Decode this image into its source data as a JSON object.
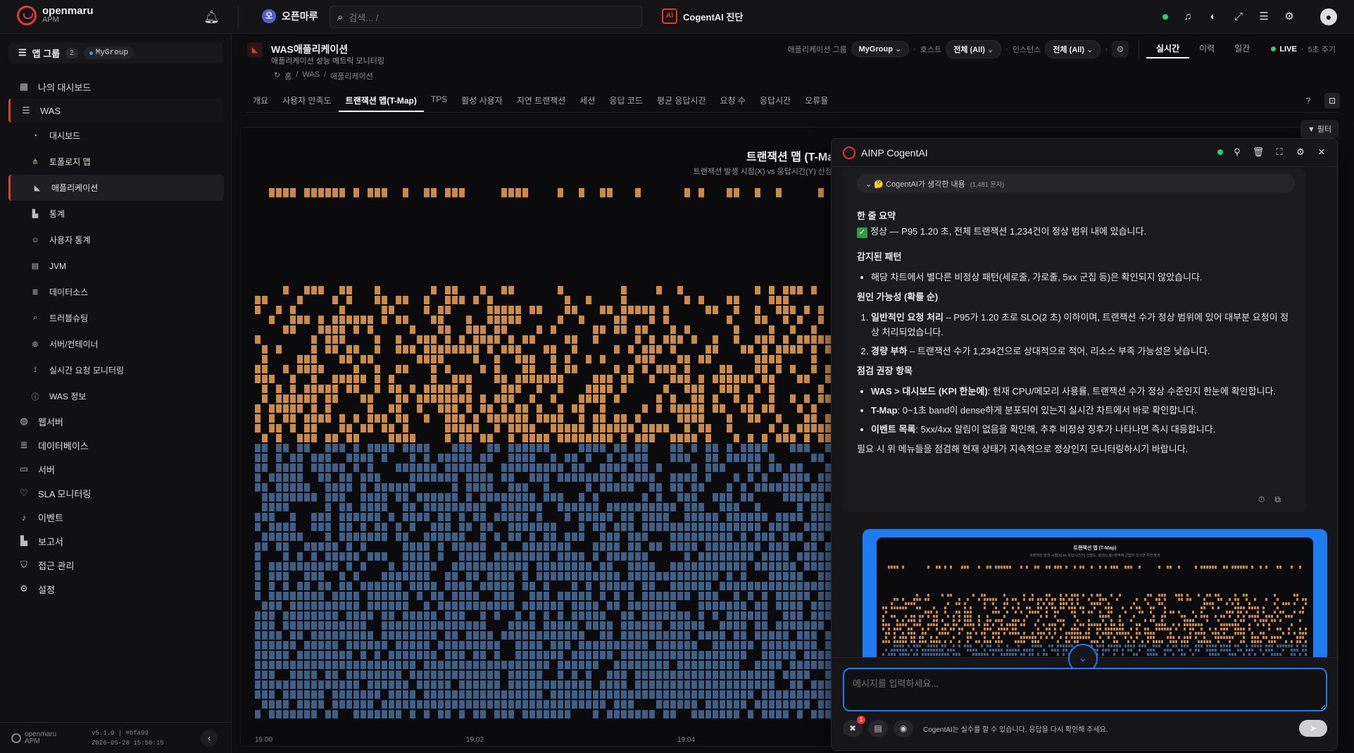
{
  "topbar": {
    "brand": "openmaru",
    "brand_sub": "APM",
    "org_initial": "오",
    "org_name": "오픈마루",
    "search_placeholder": "검색... /",
    "cogent_label": "CogentAI 진단",
    "cogent_icon_text": "AI"
  },
  "sidebar": {
    "app_group_label": "앱 그룹",
    "app_group_count": "2",
    "app_group_chip": "MyGroup",
    "items": [
      {
        "label": "나의 대시보드",
        "icon": "dashboard-grid-icon",
        "glyph": "▦",
        "level": 0
      },
      {
        "label": "WAS",
        "icon": "server-stack-icon",
        "glyph": "☰",
        "level": 0,
        "state": "parent"
      },
      {
        "label": "대시보드",
        "icon": "gauge-icon",
        "glyph": "◔",
        "level": 1
      },
      {
        "label": "토폴로지 맵",
        "icon": "topology-icon",
        "glyph": "⋔",
        "level": 1
      },
      {
        "label": "애플리케이션",
        "icon": "chart-area-icon",
        "glyph": "◣",
        "level": 1,
        "state": "active"
      },
      {
        "label": "통계",
        "icon": "bar-chart-icon",
        "glyph": "▙",
        "level": 1
      },
      {
        "label": "사용자 통계",
        "icon": "users-icon",
        "glyph": "☺",
        "level": 1
      },
      {
        "label": "JVM",
        "icon": "jvm-icon",
        "glyph": "▤",
        "level": 1
      },
      {
        "label": "데이터소스",
        "icon": "database-icon",
        "glyph": "≣",
        "level": 1
      },
      {
        "label": "트러블슈팅",
        "icon": "search-icon",
        "glyph": "⌕",
        "level": 1
      },
      {
        "label": "서버/컨테이너",
        "icon": "container-icon",
        "glyph": "⊛",
        "level": 1
      },
      {
        "label": "실시간 요청 모니터링",
        "icon": "realtime-icon",
        "glyph": "⟟",
        "level": 1
      },
      {
        "label": "WAS 정보",
        "icon": "info-icon",
        "glyph": "ⓘ",
        "level": 1
      },
      {
        "label": "웹서버",
        "icon": "globe-icon",
        "glyph": "◍",
        "level": 0
      },
      {
        "label": "데이터베이스",
        "icon": "database-icon",
        "glyph": "≣",
        "level": 0
      },
      {
        "label": "서버",
        "icon": "monitor-icon",
        "glyph": "▭",
        "level": 0
      },
      {
        "label": "SLA 모니터링",
        "icon": "heart-pulse-icon",
        "glyph": "♡",
        "level": 0
      },
      {
        "label": "이벤트",
        "icon": "bell-icon",
        "glyph": "♪",
        "level": 0
      },
      {
        "label": "보고서",
        "icon": "report-icon",
        "glyph": "▙",
        "level": 0
      },
      {
        "label": "접근 관리",
        "icon": "shield-icon",
        "glyph": "⛉",
        "level": 0
      },
      {
        "label": "설정",
        "icon": "settings-icon",
        "glyph": "⚙",
        "level": 0
      }
    ],
    "footer_brand": "openmaru",
    "footer_brand_sub": "APM",
    "version": "v5.1.0 | #bfa99",
    "build_time": "2026-05-28 15:50:15"
  },
  "page": {
    "title": "WAS애플리케이션",
    "subtitle": "애플리케이션 성능 메트릭 모니터링",
    "breadcrumb": [
      "홈",
      "/",
      "WAS",
      "/",
      "애플리케이션"
    ],
    "filter_group_label": "애플리케이션 그룹",
    "filter_group_value": "MyGroup",
    "filter_host_label": "호스트",
    "filter_host_value": "전체 (All)",
    "filter_instance_label": "인스턴스",
    "filter_instance_value": "전체 (All)",
    "modes": [
      "실시간",
      "이력",
      "일간"
    ],
    "active_mode": 0,
    "live_label": "LIVE",
    "interval_label": "5초 주기",
    "filter_button": "▼ 필터"
  },
  "tabs": [
    "개요",
    "사용자 만족도",
    "트랜잭션 맵(T-Map)",
    "TPS",
    "활성 사용자",
    "지연 트랜잭션",
    "세션",
    "응답 코드",
    "평균 응답시간",
    "요청 수",
    "응답시간",
    "오류율"
  ],
  "active_tab": 2,
  "chart_data": {
    "type": "heatmap",
    "title": "트랜잭션 맵 (T-Ma",
    "subtitle": "트랜잭션 발생 시점(X) vs 응답시간(Y) 산점도. 상단(느림) 드",
    "x_ticks": [
      "19:00",
      "19:02",
      "19:04"
    ],
    "colors": {
      "slow": "#c98a4a",
      "normal": "#3f5f86"
    }
  },
  "ai_panel": {
    "title": "AINP CogentAI",
    "thinking_label": "🤔 CogentAI가 생각한 내용",
    "thinking_count": "(1,481 문자)",
    "summary_heading": "한 줄 요약",
    "summary_text": "정상 — P95 1.20 초, 전체 트랜잭션 1,234건이 정상 범위 내에 있습니다.",
    "patterns_heading": "감지된 패턴",
    "patterns": [
      "해당 차트에서 별다른 비정상 패턴(세로줄, 가로줄, 5xx 군집 등)은 확인되지 않았습니다."
    ],
    "causes_heading": "원인 가능성 (확률 순)",
    "causes": [
      {
        "bold": "일반적인 요청 처리",
        "text": " – P95가 1.20 초로 SLO(2 초) 이하이며, 트랜잭션 수가 정상 범위에 있어 대부분 요청이 정상 처리되었습니다."
      },
      {
        "bold": "경량 부하",
        "text": " – 트랜잭션 수가 1,234건으로 상대적으로 적어, 리소스 부족 가능성은 낮습니다."
      }
    ],
    "checks_heading": "점검 권장 항목",
    "checks": [
      {
        "bold": "WAS > 대시보드 (KPI 한눈에)",
        "text": ": 현재 CPU/메모리 사용률, 트랜잭션 수가 정상 수준인지 한눈에 확인합니다."
      },
      {
        "bold": "T-Map",
        "text": ": 0~1초 band이 dense하게 분포되어 있는지 실시간 차트에서 바로 확인합니다."
      },
      {
        "bold": "이벤트 목록",
        "text": ": 5xx/4xx 알림이 없음을 확인해, 추후 비정상 징후가 나타나면 즉시 대응합니다."
      }
    ],
    "closing": "필요 시 위 메뉴들을 점검해 현재 상태가 지속적으로 정상인지 모니터링하시기 바랍니다.",
    "preview_title": "트랜잭션 맵 (T-Map)",
    "preview_sub": "트랜잭션 발생 시점(X) vs 응답시간(Y) 산점도. 상단(느림) 영역에 군집이 있으면 지연 발생",
    "input_placeholder": "메시지를 입력하세요...",
    "tools_badge": "1",
    "disclaimer": "CogentAI는 실수를 할 수 있습니다. 응답을 다시 확인해 주세요."
  }
}
